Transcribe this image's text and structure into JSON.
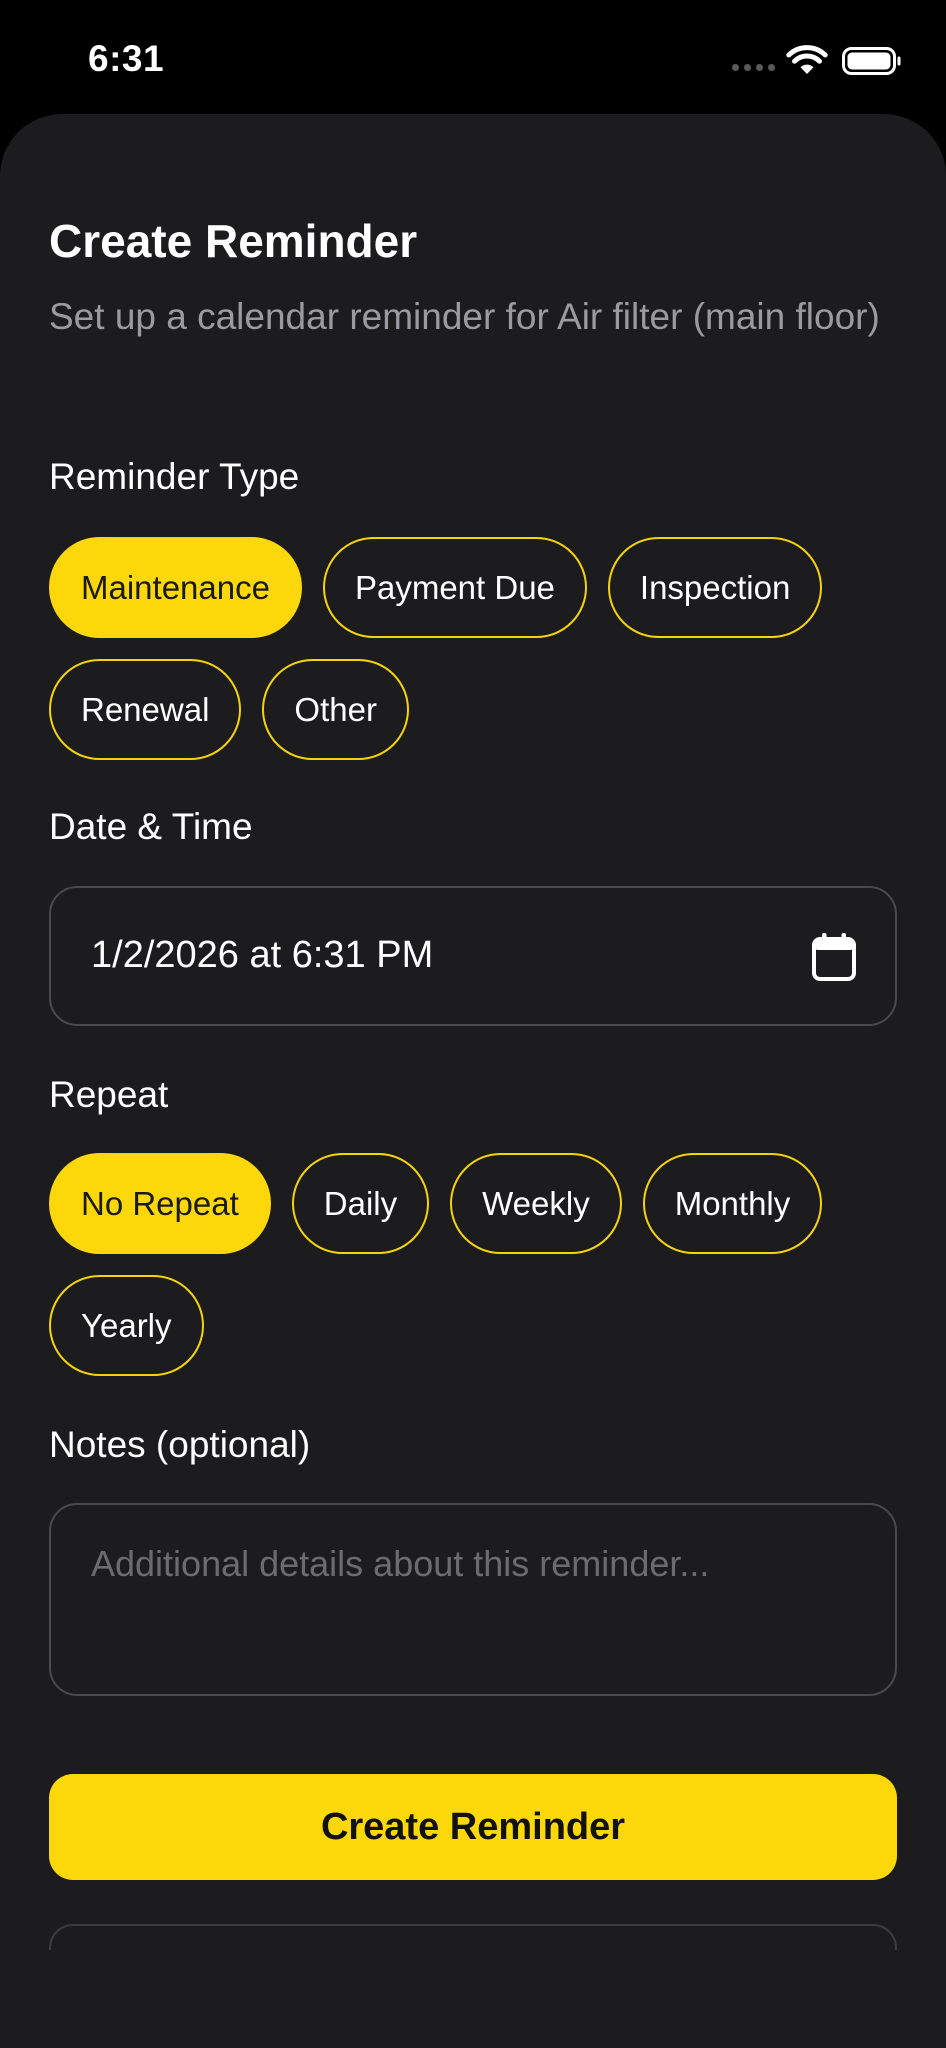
{
  "status_bar": {
    "time": "6:31"
  },
  "sheet": {
    "title": "Create Reminder",
    "subtitle": "Set up a calendar reminder for Air filter (main floor)"
  },
  "reminder_type": {
    "label": "Reminder Type",
    "selected": "Maintenance",
    "options": [
      "Maintenance",
      "Payment Due",
      "Inspection",
      "Renewal",
      "Other"
    ]
  },
  "date_time": {
    "label": "Date & Time",
    "value": "1/2/2026 at 6:31 PM",
    "icon": "calendar-icon"
  },
  "repeat": {
    "label": "Repeat",
    "selected": "No Repeat",
    "options": [
      "No Repeat",
      "Daily",
      "Weekly",
      "Monthly",
      "Yearly"
    ]
  },
  "notes": {
    "label": "Notes (optional)",
    "placeholder": "Additional details about this reminder...",
    "value": ""
  },
  "actions": {
    "create_label": "Create Reminder"
  },
  "colors": {
    "accent": "#fcd80a",
    "sheet_background": "#1c1c1e",
    "screen_background": "#000000",
    "secondary_text": "#9a9a9f"
  }
}
